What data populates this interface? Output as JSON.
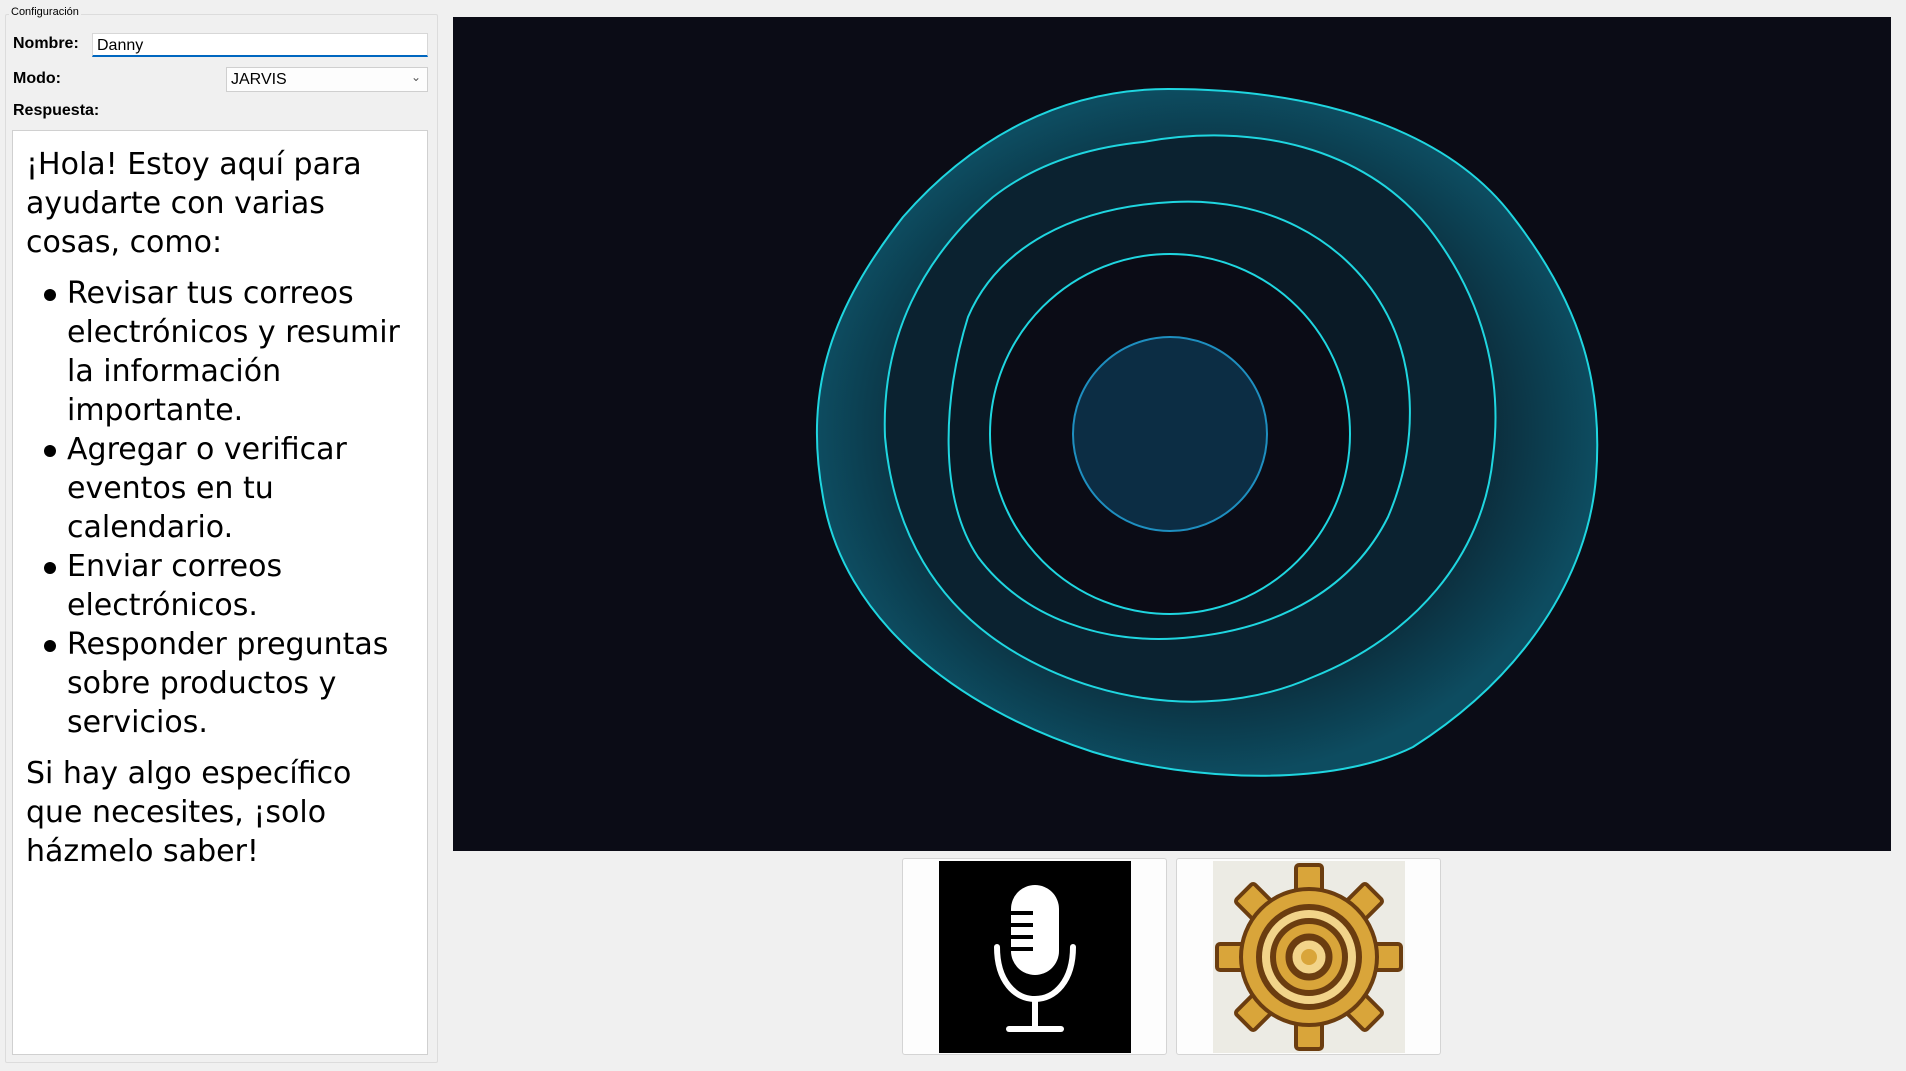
{
  "config": {
    "group_title": "Configuración",
    "name_label": "Nombre:",
    "name_value": "Danny",
    "mode_label": "Modo:",
    "mode_selected": "JARVIS",
    "response_label": "Respuesta:"
  },
  "response": {
    "intro": "¡Hola! Estoy aquí para ayudarte con varias cosas, como:",
    "items": [
      "Revisar tus correos electrónicos y resumir la información importante.",
      "Agregar o verificar eventos en tu calendario.",
      "Enviar correos electrónicos.",
      "Responder preguntas sobre productos y servicios."
    ],
    "outro": "Si hay algo específico que necesites, ¡solo házmelo saber!"
  },
  "icons": {
    "mic_button": "microphone-icon",
    "settings_button": "gear-icon",
    "mode_dropdown": "chevron-down-icon"
  },
  "colors": {
    "visualizer_bg": "#0b0c16",
    "ring_stroke": "#1fd6e0",
    "ring_fill": "#0c3a4a",
    "core_stroke": "#1e8fc0",
    "gear_gold": "#d9a53a",
    "gear_outline": "#6b3d10",
    "input_focus": "#0067c0"
  }
}
